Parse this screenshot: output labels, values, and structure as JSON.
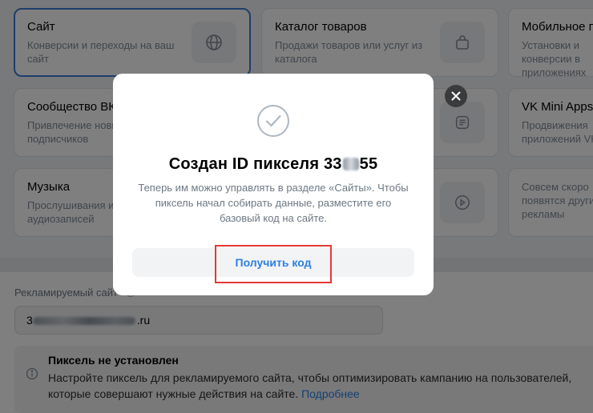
{
  "cards": [
    {
      "title": "Сайт",
      "desc": "Конверсии и переходы на ваш сайт",
      "icon": "globe-icon"
    },
    {
      "title": "Каталог товаров",
      "desc": "Продажи товаров или услуг из каталога",
      "icon": "shopping-bag-icon"
    },
    {
      "title": "Мобильное п",
      "desc": "Установки и конверсии в приложениях",
      "icon": ""
    },
    {
      "title": "Сообщество ВК",
      "desc": "Привлечение новых подписчиков",
      "icon": ""
    },
    {
      "title": "",
      "desc": "",
      "icon": "list-icon"
    },
    {
      "title": "VK Mini Apps",
      "desc": "Продвижения приложений VK",
      "icon": ""
    },
    {
      "title": "Музыка",
      "desc": "Прослушивания и аудиозаписей",
      "icon": ""
    },
    {
      "title": "",
      "desc": "",
      "icon": "play-icon"
    },
    {
      "title": "",
      "desc": "Совсем скоро появятся другие рекламы",
      "icon": ""
    }
  ],
  "form": {
    "site_label": "Рекламируемый сайт",
    "site_value_prefix": "3",
    "site_value_suffix": ".ru"
  },
  "alert": {
    "title": "Пиксель не установлен",
    "text": "Настройте пиксель для рекламируемого сайта, чтобы оптимизировать кампанию на пользователей, которые совершают нужные действия на сайте.",
    "link": "Подробнее"
  },
  "modal": {
    "title_prefix": "Создан ID пикселя 33",
    "title_suffix": "55",
    "text": "Теперь им можно управлять в разделе «Сайты». Чтобы пиксель начал собирать данные, разместите его базовый код на сайте.",
    "button_label": "Получить код"
  },
  "colors": {
    "accent": "#2d81e0",
    "selected_border": "#3f7bd6",
    "highlight": "#e53935"
  }
}
